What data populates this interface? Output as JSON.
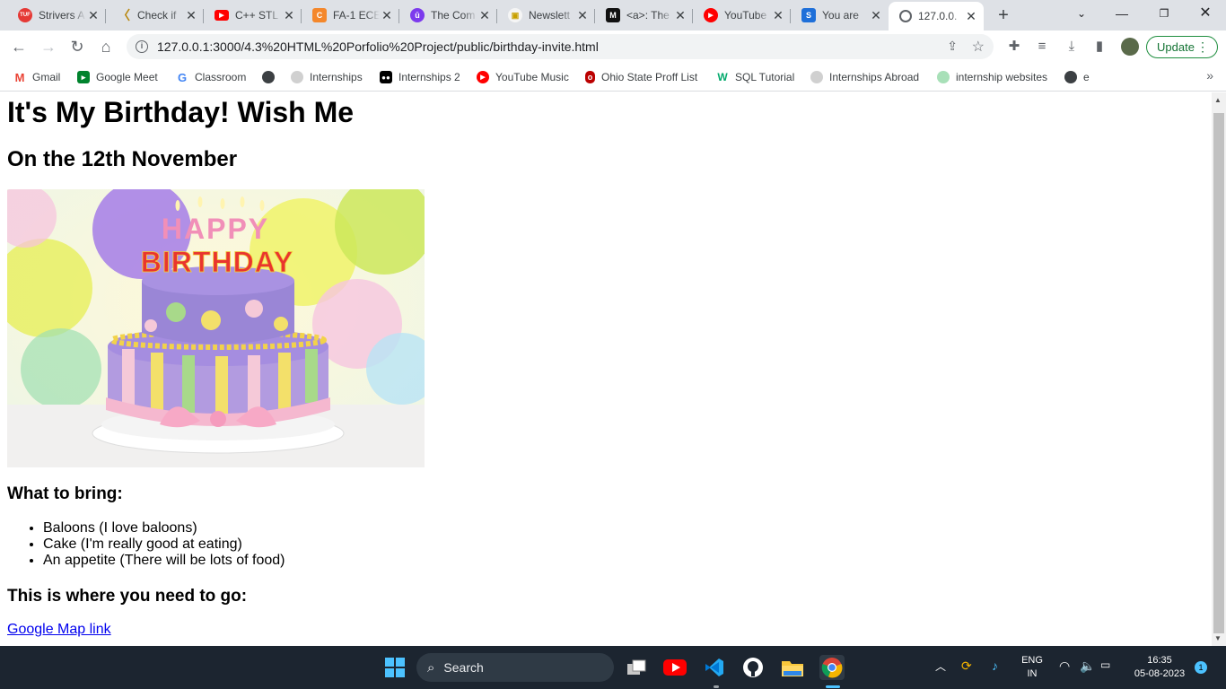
{
  "browser": {
    "tabs": [
      {
        "title": "Strivers A",
        "icon": "tuf-icon",
        "color": "#e53935",
        "glyph": "TUF"
      },
      {
        "title": "Check if",
        "icon": "codeforces-icon",
        "color": "#ffffff",
        "glyph": "〈"
      },
      {
        "title": "C++ STL",
        "icon": "youtube-icon",
        "color": "#ff0000",
        "glyph": "▶"
      },
      {
        "title": "FA-1 ECE",
        "icon": "course-icon",
        "color": "#f4872b",
        "glyph": "C"
      },
      {
        "title": "The Com",
        "icon": "udemy-icon",
        "color": "#7c3aed",
        "glyph": "ū"
      },
      {
        "title": "Newslett",
        "icon": "newsletter-icon",
        "color": "#f5f5f5",
        "glyph": "▣"
      },
      {
        "title": "<a>: The",
        "icon": "mdn-icon",
        "color": "#111111",
        "glyph": "M"
      },
      {
        "title": "YouTube",
        "icon": "youtube-music-icon",
        "color": "#ff0000",
        "glyph": "●"
      },
      {
        "title": "You are",
        "icon": "s-icon",
        "color": "#1e6fd9",
        "glyph": "S"
      },
      {
        "title": "127.0.0.",
        "icon": "globe-icon",
        "color": "#5f6368",
        "glyph": "◉"
      }
    ],
    "url": "127.0.0.1:3000/4.3%20HTML%20Porfolio%20Project/public/birthday-invite.html",
    "update_label": "Update",
    "bookmarks": [
      {
        "label": "Gmail",
        "icon": "gmail-icon"
      },
      {
        "label": "Google Meet",
        "icon": "meet-icon"
      },
      {
        "label": "Classroom",
        "icon": "google-icon"
      },
      {
        "label": "",
        "icon": "globe-icon"
      },
      {
        "label": "Internships",
        "icon": "github-icon"
      },
      {
        "label": "Internships 2",
        "icon": "medium-icon"
      },
      {
        "label": "YouTube Music",
        "icon": "youtube-music-icon"
      },
      {
        "label": "Ohio State Proff List",
        "icon": "ohio-state-icon"
      },
      {
        "label": "SQL Tutorial",
        "icon": "w3schools-icon"
      },
      {
        "label": "Internships Abroad",
        "icon": "github-icon"
      },
      {
        "label": "internship websites",
        "icon": "chatgpt-icon"
      },
      {
        "label": "e",
        "icon": "globe-icon"
      }
    ]
  },
  "page": {
    "heading": "It's My Birthday! Wish Me",
    "date": "On the 12th November",
    "bring_heading": "What to bring:",
    "items": [
      "Baloons (I love baloons)",
      "Cake (I'm really good at eating)",
      "An appetite (There will be lots of food)"
    ],
    "where_heading": "This is where you need to go:",
    "map_link": "Google Map link",
    "cake_text": "HAPPY BIRTHDAY"
  },
  "taskbar": {
    "search_label": "Search",
    "language": "ENG",
    "region": "IN",
    "time": "16:35",
    "date": "05-08-2023",
    "notifications": "1"
  }
}
